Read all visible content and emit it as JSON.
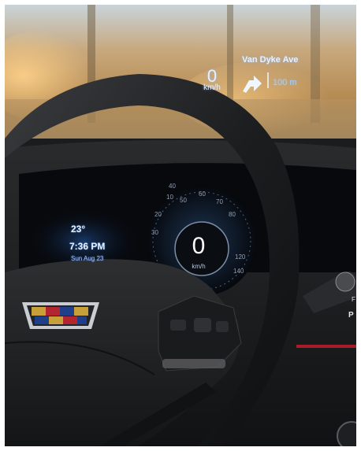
{
  "hud": {
    "speed": "0",
    "speed_unit": "km/h",
    "street": "Van Dyke Ave",
    "distance": "100 m",
    "turn_icon": "turn-right-arrow-icon"
  },
  "cluster": {
    "temperature": "23°",
    "time": "7:36 PM",
    "date": "Sun Aug 23",
    "speed": "0",
    "speed_unit": "km/h",
    "tick_labels": [
      "10",
      "20",
      "30",
      "40",
      "50",
      "60",
      "70",
      "80",
      "120",
      "140"
    ]
  },
  "gear": {
    "upper": "F",
    "selected": "P"
  },
  "wheel": {
    "logo": "cadillac-crest-logo",
    "controls": [
      "voice-icon",
      "phone-icon",
      "volume-scroll-wheel",
      "star-favorite-icon"
    ]
  }
}
